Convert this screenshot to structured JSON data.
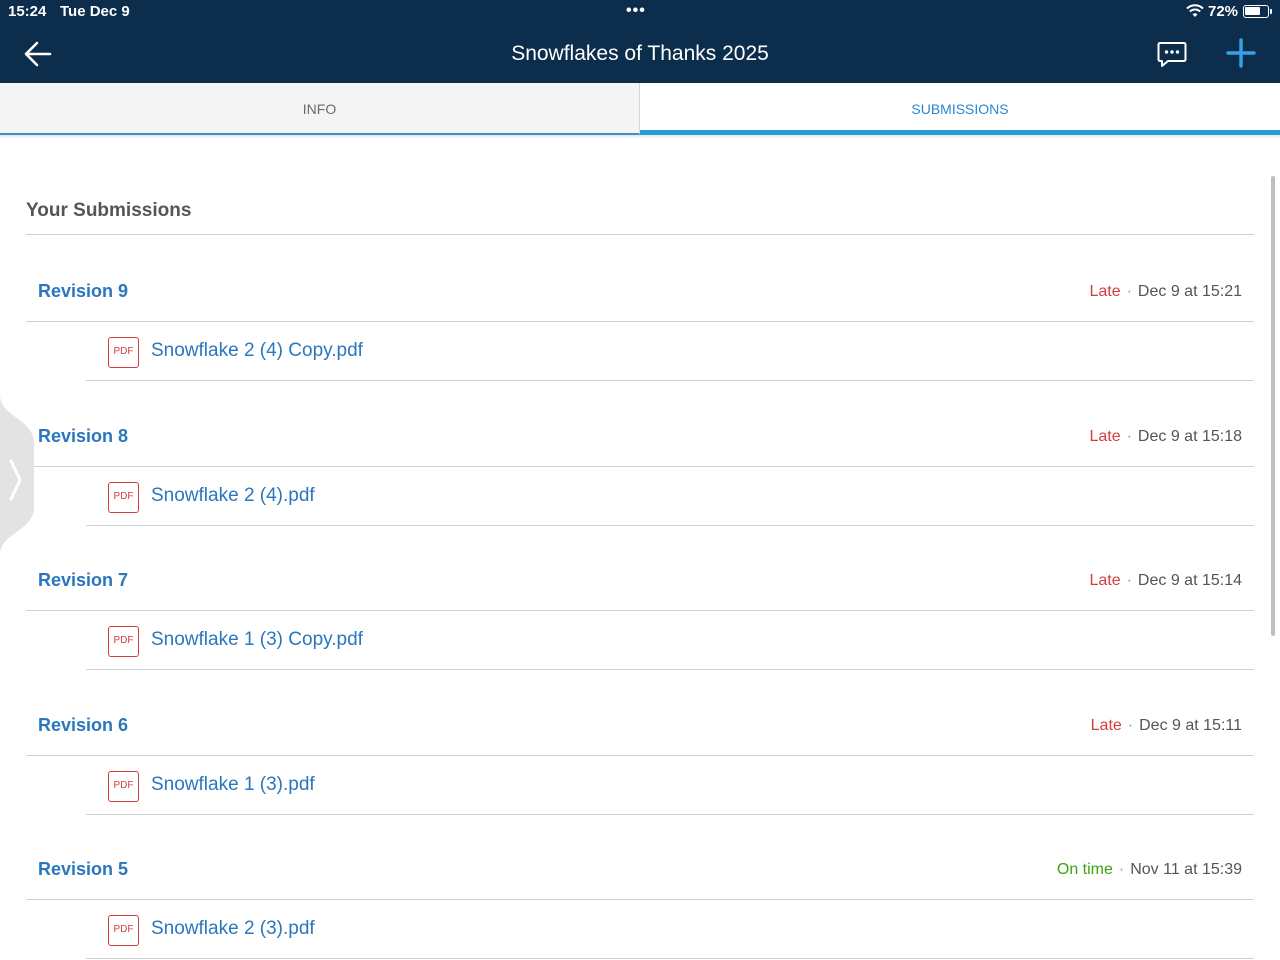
{
  "status_bar": {
    "time": "15:24",
    "date": "Tue Dec 9",
    "dots": "•••",
    "battery": "72%",
    "battery_level": 0.72
  },
  "header": {
    "title": "Snowflakes of Thanks 2025",
    "back_icon": "arrow-left-icon",
    "chat_icon": "comment-bubble-icon",
    "add_icon": "plus-icon"
  },
  "tabs": [
    {
      "label": "INFO",
      "active": false
    },
    {
      "label": "SUBMISSIONS",
      "active": true
    }
  ],
  "section_title": "Your Submissions",
  "revisions": [
    {
      "label": "Revision 9",
      "status": "Late",
      "date": "Dec 9 at 15:21",
      "file": "Snowflake 2 (4) Copy.pdf",
      "file_badge": "PDF"
    },
    {
      "label": "Revision 8",
      "status": "Late",
      "date": "Dec 9 at 15:18",
      "file": "Snowflake 2 (4).pdf",
      "file_badge": "PDF"
    },
    {
      "label": "Revision 7",
      "status": "Late",
      "date": "Dec 9 at 15:14",
      "file": "Snowflake 1 (3) Copy.pdf",
      "file_badge": "PDF"
    },
    {
      "label": "Revision 6",
      "status": "Late",
      "date": "Dec 9 at 15:11",
      "file": "Snowflake 1 (3).pdf",
      "file_badge": "PDF"
    },
    {
      "label": "Revision 5",
      "status": "On time",
      "date": "Nov 11 at 15:39",
      "file": "Snowflake 2 (3).pdf",
      "file_badge": "PDF"
    }
  ],
  "separator": "·",
  "colors": {
    "header_bg": "#0c2d4c",
    "accent": "#2a76bf",
    "late": "#d43d3d",
    "on_time": "#3aa312"
  }
}
